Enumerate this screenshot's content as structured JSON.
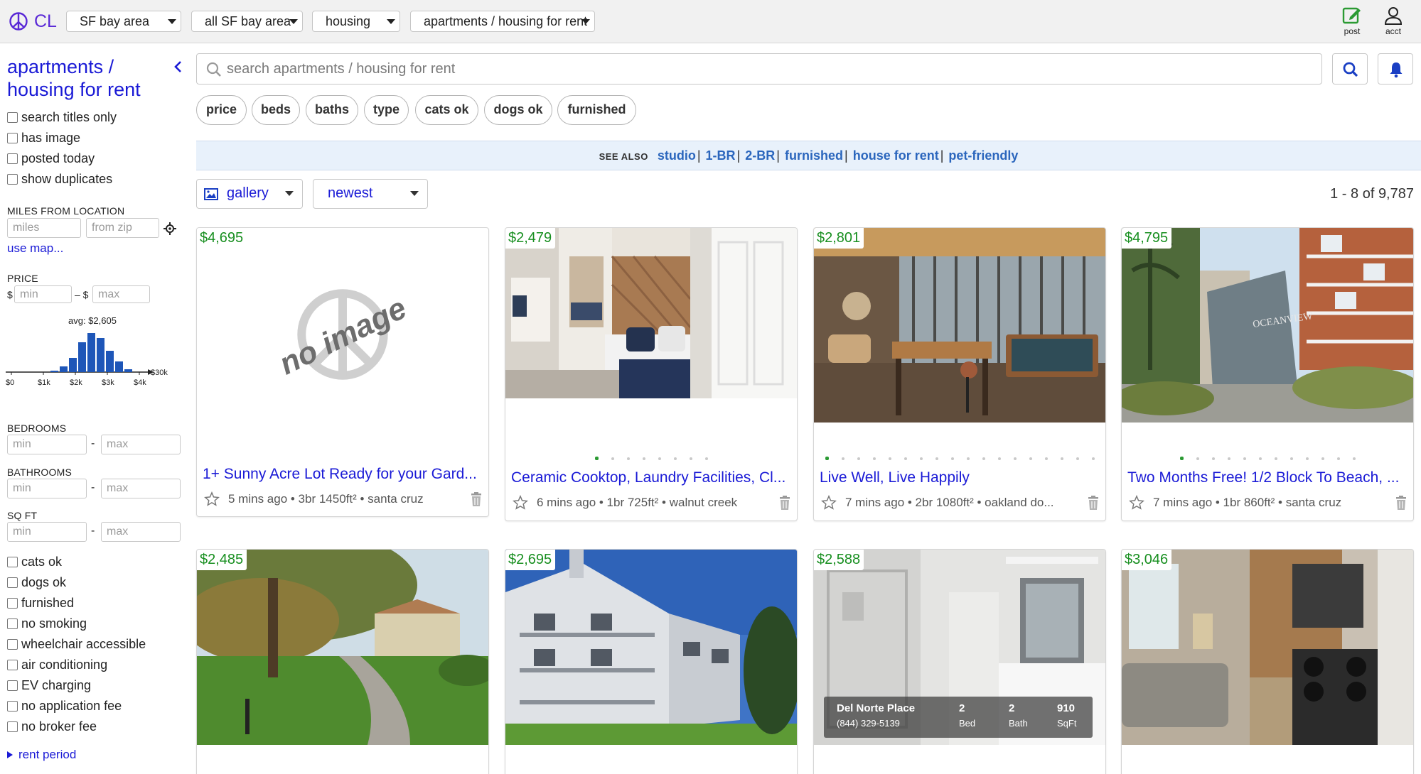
{
  "topbar": {
    "logo_text": "CL",
    "selects": [
      "SF bay area",
      "all SF bay area",
      "housing",
      "apartments / housing for rent"
    ],
    "post_label": "post",
    "acct_label": "acct"
  },
  "sidebar": {
    "title": "apartments / housing for rent",
    "checks_top": [
      "search titles only",
      "has image",
      "posted today",
      "show duplicates"
    ],
    "miles_label": "MILES FROM LOCATION",
    "miles_placeholder": "miles",
    "zip_placeholder": "from zip",
    "use_map": "use map...",
    "price_label": "PRICE",
    "price_currency": "$",
    "price_dash": "– $",
    "price_min": "min",
    "price_max": "max",
    "avg_label": "avg: $2,605",
    "histogram": {
      "bars": [
        2,
        8,
        20,
        42,
        55,
        48,
        30,
        15,
        4
      ],
      "tick_labels": [
        "$0",
        "$1k",
        "$2k",
        "$3k",
        "$4k"
      ],
      "end_label": "$30k"
    },
    "bedrooms_label": "BEDROOMS",
    "bathrooms_label": "BATHROOMS",
    "sqft_label": "SQ FT",
    "range_min": "min",
    "range_max": "max",
    "range_dash": "-",
    "checks_bottom": [
      "cats ok",
      "dogs ok",
      "furnished",
      "no smoking",
      "wheelchair accessible",
      "air conditioning",
      "EV charging",
      "no application fee",
      "no broker fee"
    ],
    "rent_period": "rent period"
  },
  "search": {
    "placeholder": "search apartments / housing for rent"
  },
  "filters": [
    "price",
    "beds",
    "baths",
    "type",
    "cats ok",
    "dogs ok",
    "furnished"
  ],
  "see_also": {
    "label": "SEE ALSO",
    "links": [
      "studio",
      "1-BR",
      "2-BR",
      "furnished",
      "house for rent",
      "pet-friendly"
    ]
  },
  "view": {
    "mode": "gallery",
    "sort": "newest",
    "count": "1 - 8 of 9,787"
  },
  "listings": [
    {
      "price": "$4,695",
      "title": "1+ Sunny Acre Lot Ready for your Gard...",
      "meta": "5 mins ago • 3br 1450ft² • santa cruz",
      "image": "none",
      "no_image_text": "no image",
      "dots": 0,
      "active": 0
    },
    {
      "price": "$2,479",
      "title": "Ceramic Cooktop, Laundry Facilities, Cl...",
      "meta": "6 mins ago • 1br 725ft² • walnut creek",
      "image": "bedroom",
      "dots": 8,
      "active": 0
    },
    {
      "price": "$2,801",
      "title": "Live Well, Live Happily",
      "meta": "7 mins ago • 2br 1080ft² • oakland do...",
      "image": "lounge",
      "dots": 18,
      "active": 0
    },
    {
      "price": "$4,795",
      "title": "Two Months Free! 1/2 Block To Beach, ...",
      "meta": "7 mins ago • 1br 860ft² • santa cruz",
      "image": "exterior",
      "dots": 12,
      "active": 0
    },
    {
      "price": "$2,485",
      "title": "",
      "meta": "",
      "image": "garden"
    },
    {
      "price": "$2,695",
      "title": "",
      "meta": "",
      "image": "building"
    },
    {
      "price": "$2,588",
      "title": "",
      "meta": "",
      "image": "bathroom",
      "overlay": {
        "name": "Del Norte Place",
        "phone": "(844) 329-5139",
        "bed_n": "2",
        "bed_l": "Bed",
        "bath_n": "2",
        "bath_l": "Bath",
        "sqft_n": "910",
        "sqft_l": "SqFt"
      }
    },
    {
      "price": "$3,046",
      "title": "",
      "meta": "",
      "image": "kitchen"
    }
  ],
  "colors": {
    "link_blue": "#1a1ad6",
    "price_green": "#188f20",
    "logo_purple": "#5a29d6",
    "seealso_bg": "#e8f1fb"
  }
}
